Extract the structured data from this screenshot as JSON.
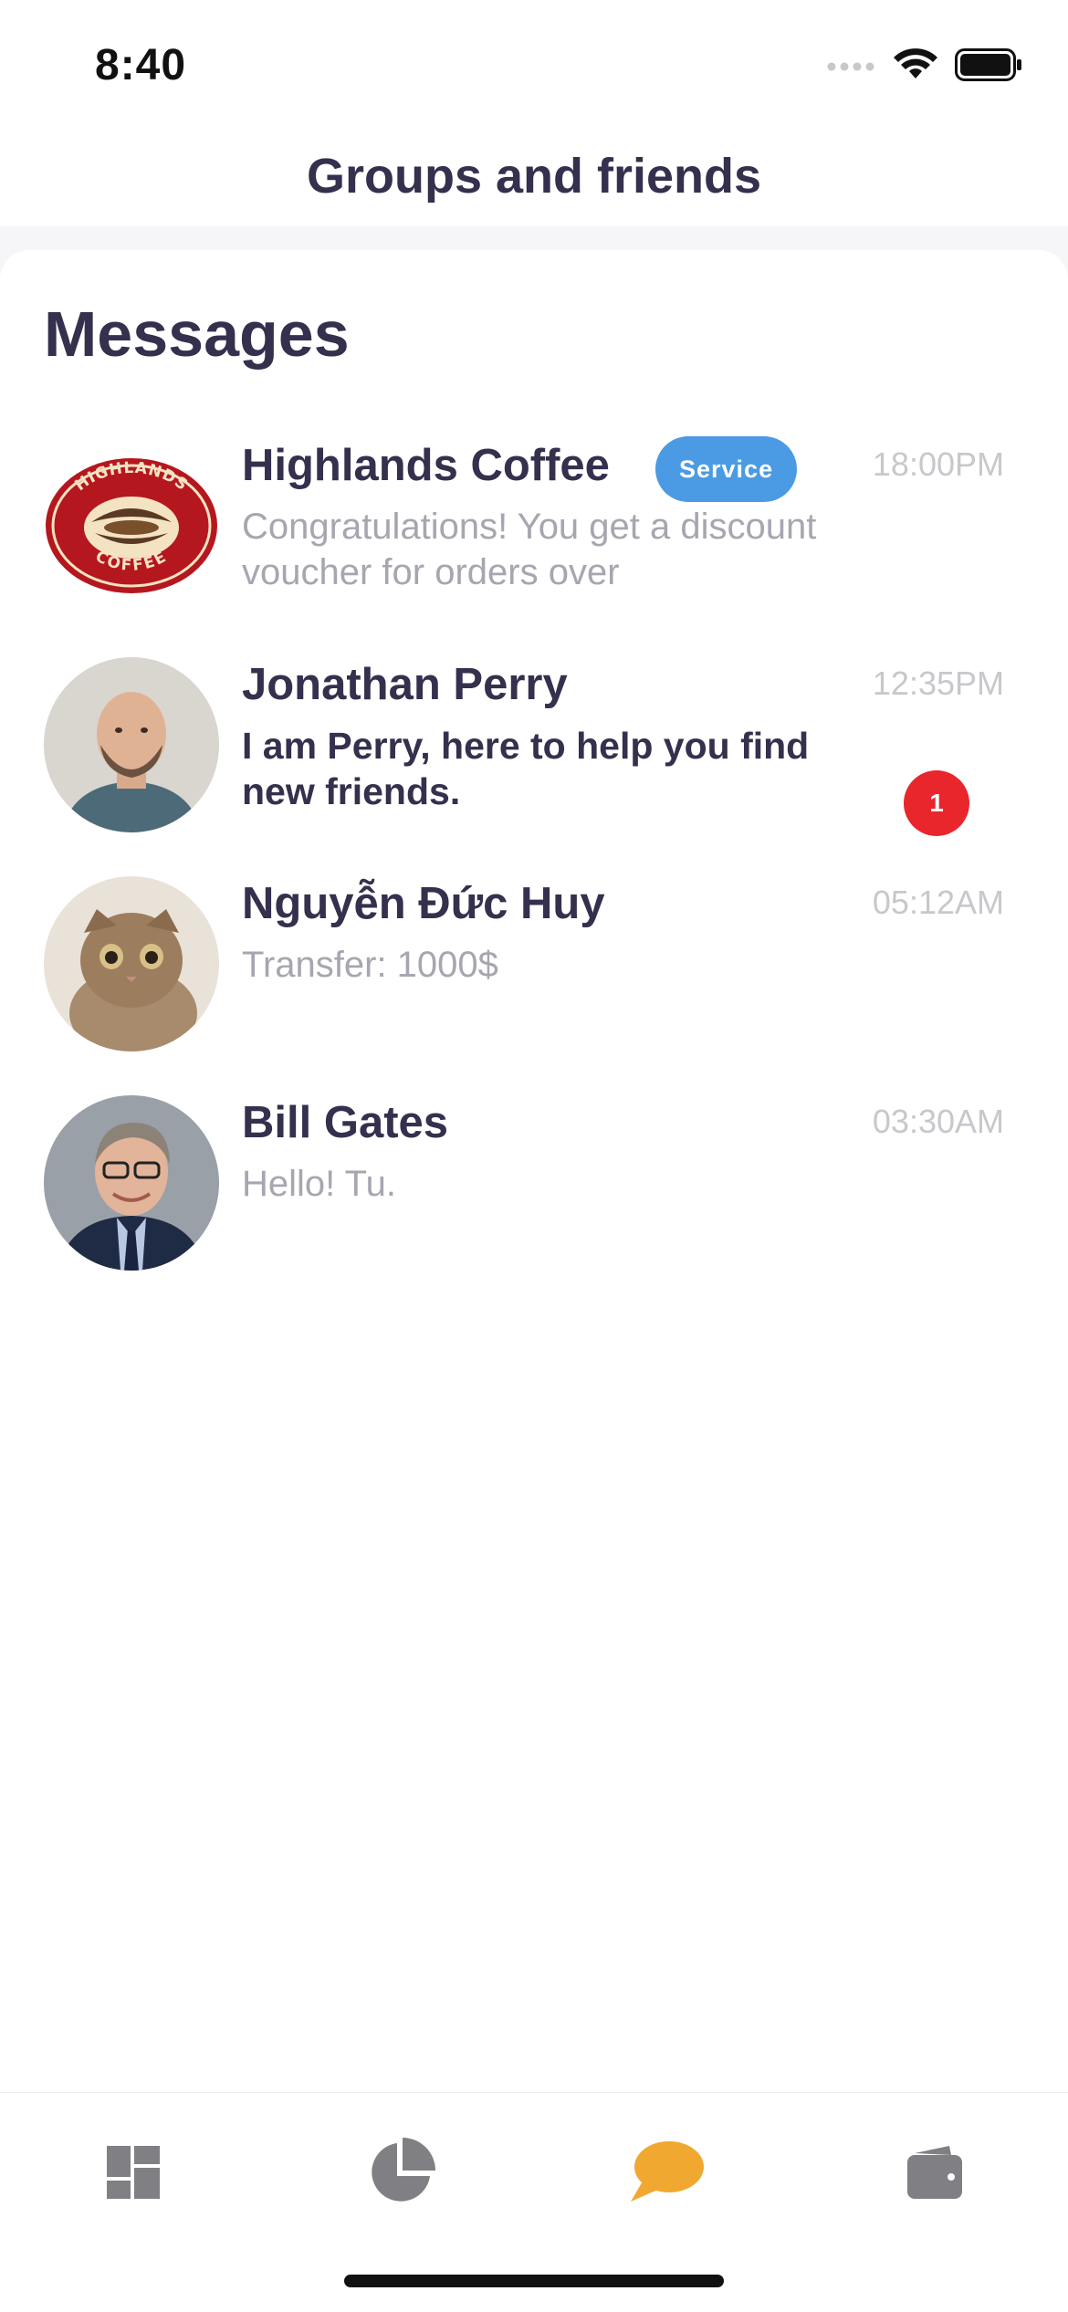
{
  "status_bar": {
    "time": "8:40"
  },
  "header": {
    "title": "Groups and friends"
  },
  "messages": {
    "section_title": "Messages",
    "items": [
      {
        "name": "Highlands Coffee",
        "badge": "Service",
        "preview": "Congratulations! You get a discount voucher for orders over",
        "time": "18:00PM",
        "unread_count": null,
        "avatar": "highlands-coffee-logo"
      },
      {
        "name": "Jonathan Perry",
        "badge": null,
        "preview": "I am Perry, here to help you find new friends.",
        "time": "12:35PM",
        "unread_count": "1",
        "avatar": "jonathan-perry-photo"
      },
      {
        "name": "Nguyễn Đức Huy",
        "badge": null,
        "preview": "Transfer: 1000$",
        "time": "05:12AM",
        "unread_count": null,
        "avatar": "cat-photo"
      },
      {
        "name": "Bill Gates",
        "badge": null,
        "preview": "Hello! Tu.",
        "time": "03:30AM",
        "unread_count": null,
        "avatar": "bill-gates-photo"
      }
    ]
  },
  "highlands_logo": {
    "top_text": "HIGHLANDS",
    "bottom_text": "COFFEE"
  },
  "tab_bar": {
    "tabs": [
      {
        "icon": "dashboard-icon",
        "active": false
      },
      {
        "icon": "pie-chart-icon",
        "active": false
      },
      {
        "icon": "chat-bubble-icon",
        "active": true
      },
      {
        "icon": "wallet-icon",
        "active": false
      }
    ]
  },
  "colors": {
    "text_primary": "#34304d",
    "text_secondary": "#a7a6b0",
    "service_badge": "#4a9be3",
    "unread_badge": "#e8262b",
    "tab_active": "#f0a830",
    "tab_inactive": "#7f7f84"
  }
}
